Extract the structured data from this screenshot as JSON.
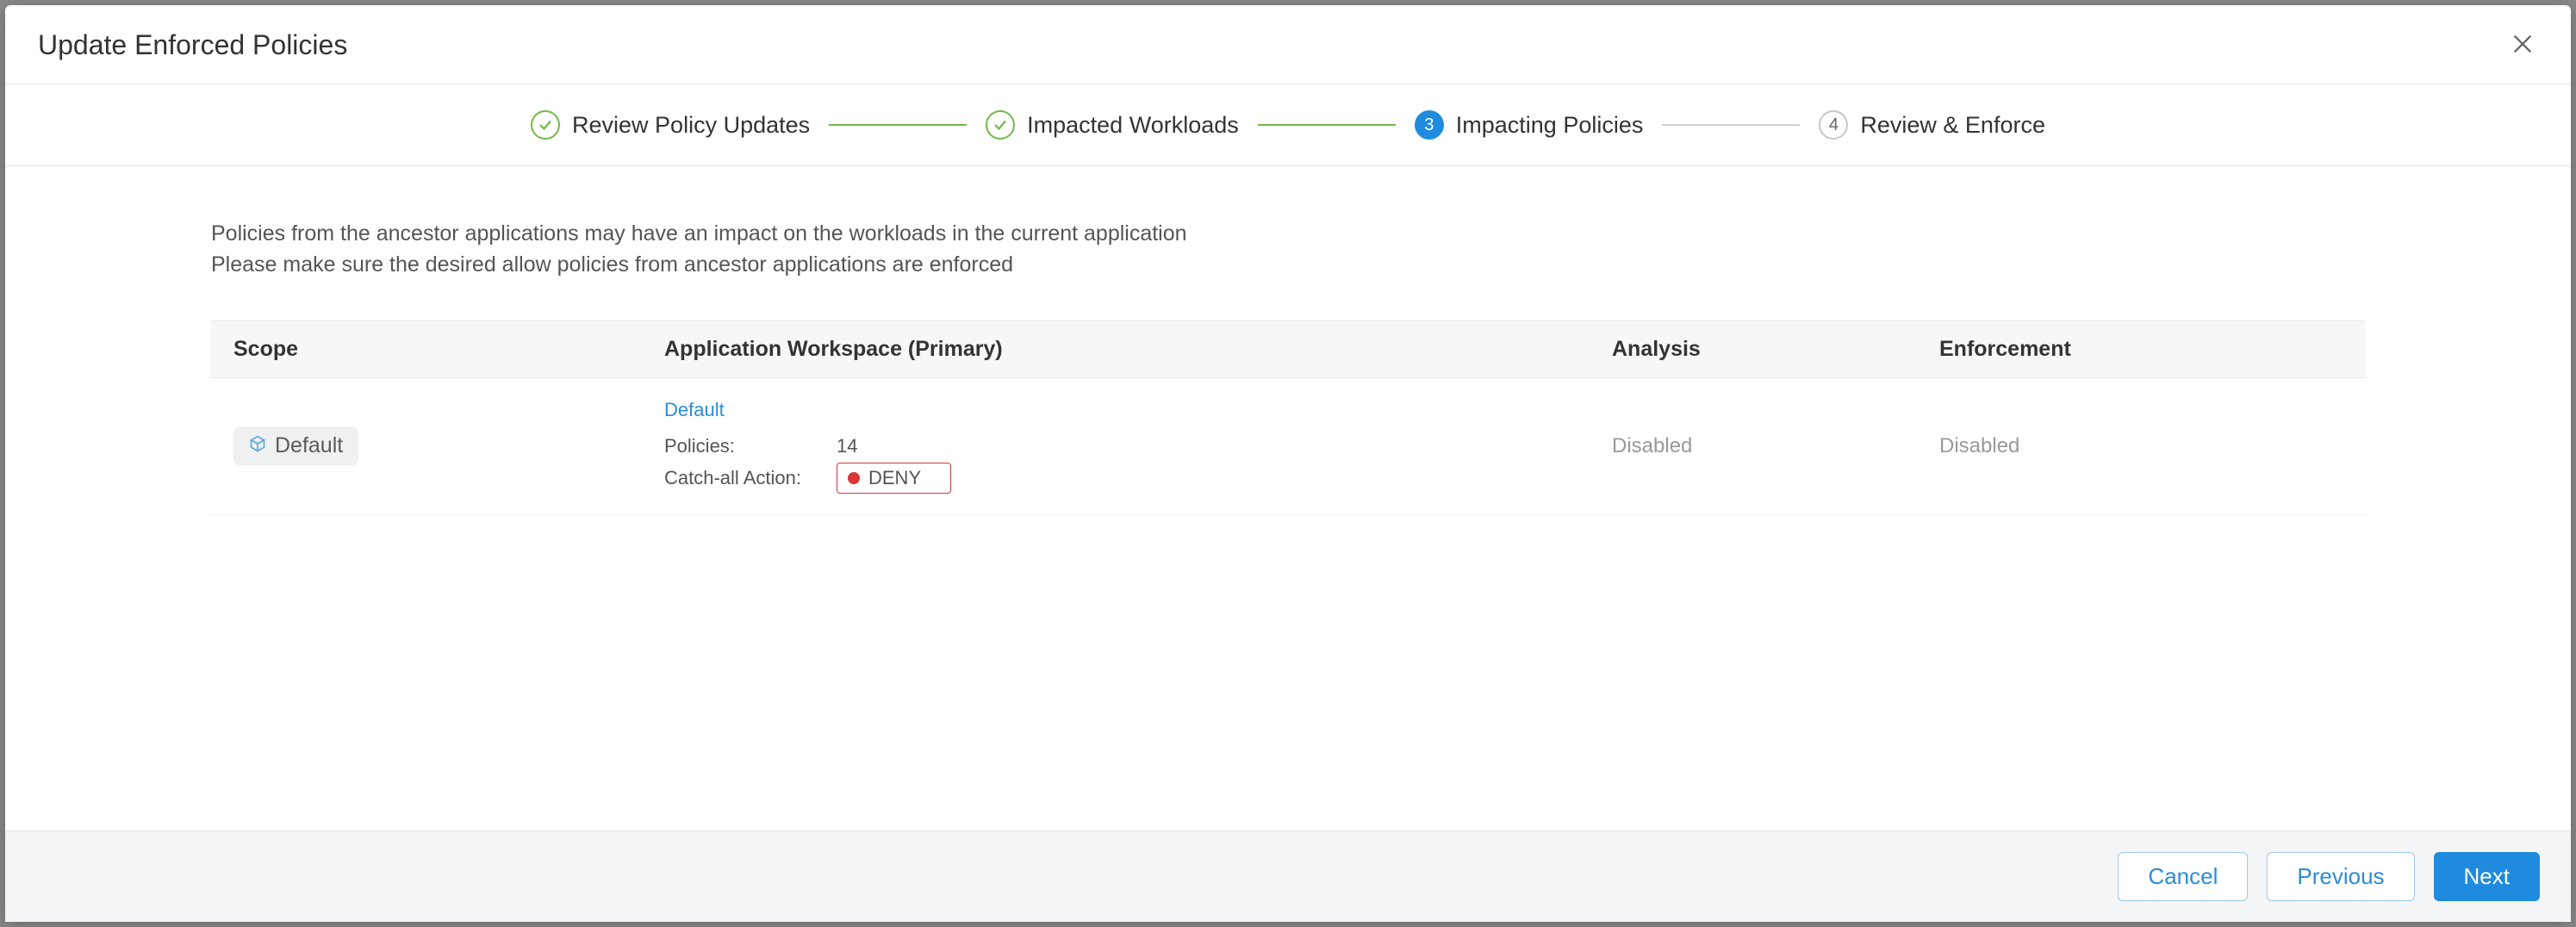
{
  "modal": {
    "title": "Update Enforced Policies"
  },
  "stepper": {
    "step1_label": "Review Policy Updates",
    "step2_label": "Impacted Workloads",
    "step3_label": "Impacting Policies",
    "step3_num": "3",
    "step4_label": "Review & Enforce",
    "step4_num": "4"
  },
  "description": {
    "line1": "Policies from the ancestor applications may have an impact on the workloads in the current application",
    "line2": "Please make sure the desired allow policies from ancestor applications are enforced"
  },
  "table": {
    "headers": {
      "scope": "Scope",
      "workspace": "Application Workspace (Primary)",
      "analysis": "Analysis",
      "enforcement": "Enforcement"
    },
    "row": {
      "scope_label": "Default",
      "ws_link": "Default",
      "policies_label": "Policies:",
      "policies_value": "14",
      "catchall_label": "Catch-all Action:",
      "catchall_value": "DENY",
      "analysis_value": "Disabled",
      "enforcement_value": "Disabled"
    }
  },
  "footer": {
    "cancel": "Cancel",
    "previous": "Previous",
    "next": "Next"
  }
}
